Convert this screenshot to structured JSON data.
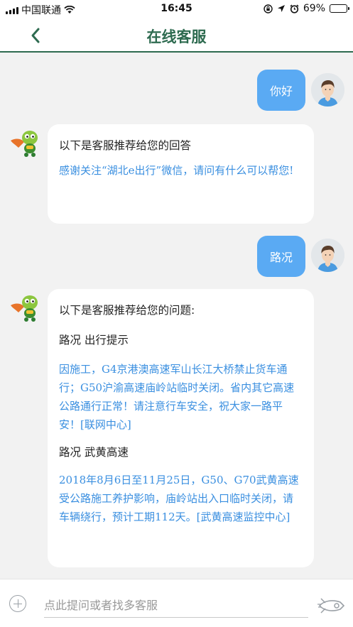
{
  "status_bar": {
    "carrier": "中国联通",
    "time": "16:45",
    "battery": "69%",
    "battery_level": 0.69
  },
  "nav": {
    "title": "在线客服",
    "back_icon": "chevron-left-icon"
  },
  "messages": [
    {
      "from": "user",
      "text": "你好"
    },
    {
      "from": "bot",
      "intro": "以下是客服推荐给您的回答",
      "body": "感谢关注“湖北e出行”微信，请问有什么可以帮您!"
    },
    {
      "from": "user",
      "text": "路况"
    },
    {
      "from": "bot",
      "intro": "以下是客服推荐给您的问题:",
      "sections": [
        {
          "heading": "路况 出行提示",
          "body": "因施工，G4京港澳高速军山长江大桥禁止货车通行；G50沪渝高速庙岭站临时关闭。省内其它高速公路通行正常！请注意行车安全，祝大家一路平安！[联网中心]"
        },
        {
          "heading": "路况 武黄高速",
          "body": "2018年8月6日至11月25日，G50、G70武黄高速受公路施工养护影响，庙岭站出入口临时关闭，请车辆绕行，预计工期112天。[武黄高速监控中心]"
        }
      ]
    }
  ],
  "input_bar": {
    "placeholder": "点此提问或者找多客服",
    "value": "",
    "plus_icon": "plus-circle-icon",
    "send_icon": "rocket-send-icon"
  },
  "colors": {
    "accent": "#2e6b50",
    "user_bubble": "#5aaaf3",
    "link_text": "#3a8fe0",
    "background": "#f2f2f2"
  }
}
